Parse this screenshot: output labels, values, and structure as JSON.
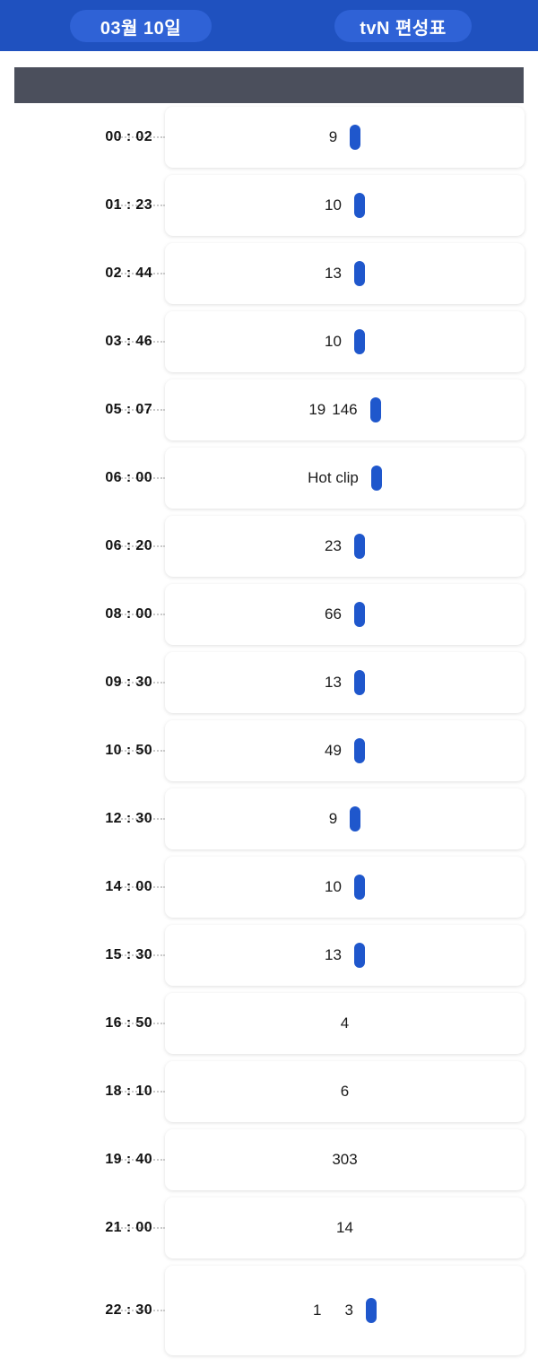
{
  "header": {
    "date_chip": "03월 10일",
    "channel_chip": "tvN 편성표",
    "bar_color": "#1f51bf",
    "chip_color": "#2f62d6"
  },
  "header_strip": {
    "label": "",
    "color": "#4b4f5c"
  },
  "accent_color": "#1f57cc",
  "schedule": {
    "rows": [
      {
        "time": "00 : 02",
        "text": "9",
        "text2": "",
        "pill": true,
        "tall": false
      },
      {
        "time": "01 : 23",
        "text": "10",
        "text2": "",
        "pill": true,
        "tall": false
      },
      {
        "time": "02 : 44",
        "text": "13",
        "text2": "",
        "pill": true,
        "tall": false
      },
      {
        "time": "03 : 46",
        "text": "10",
        "text2": "",
        "pill": true,
        "tall": false
      },
      {
        "time": "05 : 07",
        "text": "19",
        "text2": "146",
        "pill": true,
        "tall": false
      },
      {
        "time": "06 : 00",
        "text": "Hot clip",
        "text2": "",
        "pill": true,
        "tall": false
      },
      {
        "time": "06 : 20",
        "text": "23",
        "text2": "",
        "pill": true,
        "tall": false
      },
      {
        "time": "08 : 00",
        "text": "66",
        "text2": "",
        "pill": true,
        "tall": false
      },
      {
        "time": "09 : 30",
        "text": "13",
        "text2": "",
        "pill": true,
        "tall": false
      },
      {
        "time": "10 : 50",
        "text": "49",
        "text2": "",
        "pill": true,
        "tall": false
      },
      {
        "time": "12 : 30",
        "text": "9",
        "text2": "",
        "pill": true,
        "tall": false
      },
      {
        "time": "14 : 00",
        "text": "10",
        "text2": "",
        "pill": true,
        "tall": false
      },
      {
        "time": "15 : 30",
        "text": "13",
        "text2": "",
        "pill": true,
        "tall": false
      },
      {
        "time": "16 : 50",
        "text": "4",
        "text2": "",
        "pill": false,
        "tall": false
      },
      {
        "time": "18 : 10",
        "text": "6",
        "text2": "",
        "pill": false,
        "tall": false
      },
      {
        "time": "19 : 40",
        "text": "303",
        "text2": "",
        "pill": false,
        "tall": false
      },
      {
        "time": "21 : 00",
        "text": "14",
        "text2": "",
        "pill": false,
        "tall": false
      },
      {
        "time": "22 : 30",
        "text": "1",
        "text2": "3",
        "pill": true,
        "tall": true
      }
    ]
  }
}
